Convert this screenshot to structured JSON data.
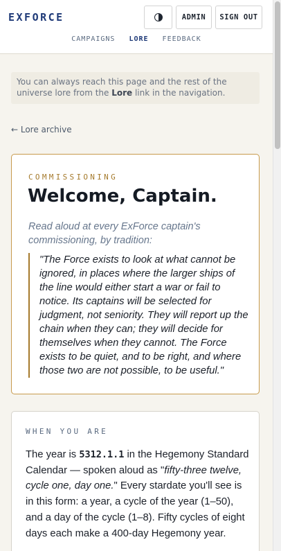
{
  "header": {
    "logo": "EXFORCE",
    "admin_label": "ADMIN",
    "signout_label": "SIGN OUT",
    "theme_icon": "contrast-icon"
  },
  "nav": {
    "items": [
      {
        "label": "CAMPAIGNS",
        "active": false
      },
      {
        "label": "LORE",
        "active": true
      },
      {
        "label": "FEEDBACK",
        "active": false
      }
    ]
  },
  "notice": {
    "text_before": "You can always reach this page and the rest of the universe lore from the ",
    "link_word": "Lore",
    "text_after": " link in the navigation."
  },
  "back_link": "← Lore archive",
  "commissioning": {
    "eyebrow": "COMMISSIONING",
    "title": "Welcome, Captain.",
    "lead": "Read aloud at every ExForce captain's commissioning, by tradition:",
    "quote": "\"The Force exists to look at what cannot be ignored, in places where the larger ships of the line would either start a war or fail to notice. Its captains will be selected for judgment, not seniority. They will report up the chain when they can; they will decide for themselves when they cannot. The Force exists to be quiet, and to be right, and where those two are not possible, to be useful.\""
  },
  "when_you_are": {
    "eyebrow": "WHEN YOU ARE",
    "p_year_is": "The year is ",
    "stardate": "5312.1.1",
    "p_calendar": " in the Hegemony Standard Calendar — spoken aloud as \"",
    "spoken": "fifty-three twelve, cycle one, day one.",
    "p_rest": "\" Every stardate you'll see is in this form: a year, a cycle of the year (1–50), and a day of the cycle (1–8). Fifty cycles of eight days each make a 400-day Hegemony year."
  },
  "colors": {
    "brand": "#1f3a78",
    "accent_gold": "#a57a2c",
    "background": "#f6f4ee"
  }
}
